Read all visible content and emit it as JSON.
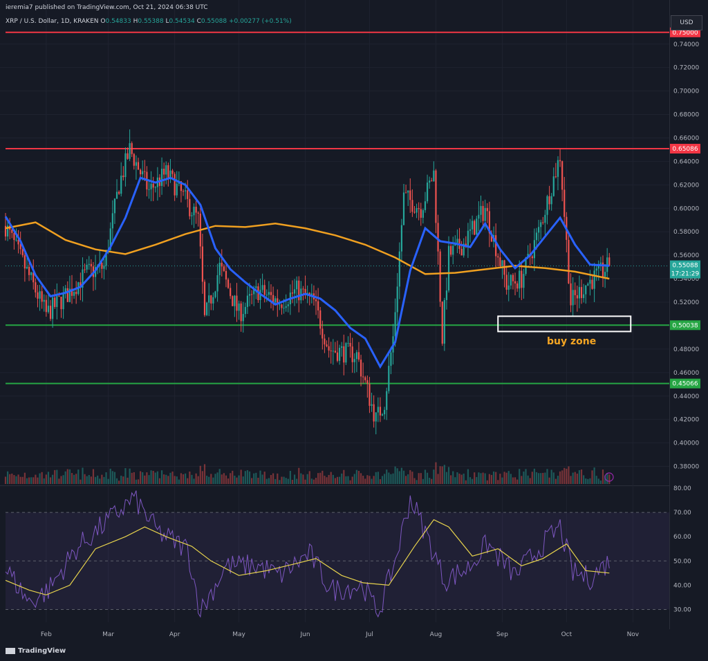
{
  "header": {
    "publisher": "ieremia7 published on TradingView.com, Oct 21, 2024 06:38 UTC",
    "symbol": "XRP / U.S. Dollar, 1D, KRAKEN",
    "o_label": "O",
    "o_value": "0.54833",
    "h_label": "H",
    "h_value": "0.55388",
    "l_label": "L",
    "l_value": "0.54534",
    "c_label": "C",
    "c_value": "0.55088",
    "change": "+0.00277 (+0.51%)"
  },
  "currency": "USD",
  "annotation": "buy zone",
  "watermark": "TradingView",
  "colors": {
    "background": "#161a25",
    "up": "#26a69a",
    "down": "#ef5350",
    "ema_fast": "#2962ff",
    "ema_slow": "#f0a020",
    "resistance": "#f23645",
    "support": "#26a644",
    "rsi": "#7e57c2",
    "rsi_ma": "#e8d44d"
  },
  "price_tags": {
    "top_line": "0.75000",
    "resistance": "0.65086",
    "last": "0.55088",
    "countdown": "17:21:29",
    "support1": "0.50038",
    "support2": "0.45066"
  },
  "chart_data": [
    {
      "type": "candlestick",
      "price_axis": [
        "0.74000",
        "0.72000",
        "0.70000",
        "0.68000",
        "0.66000",
        "0.64000",
        "0.62000",
        "0.60000",
        "0.58000",
        "0.56000",
        "0.54000",
        "0.52000",
        "0.48000",
        "0.46000",
        "0.44000",
        "0.42000",
        "0.40000",
        "0.38000"
      ],
      "ylim": [
        0.365,
        0.754
      ],
      "time_axis": [
        "Feb",
        "Mar",
        "Apr",
        "May",
        "Jun",
        "Jul",
        "Aug",
        "Sep",
        "Oct",
        "Nov"
      ],
      "horizontal_lines": [
        {
          "role": "resistance",
          "value": 0.75
        },
        {
          "role": "resistance",
          "value": 0.65086
        },
        {
          "role": "support",
          "value": 0.50038
        },
        {
          "role": "support",
          "value": 0.45066
        }
      ],
      "buy_zone": {
        "from": 0.495,
        "to": 0.508,
        "x_start": "2024-08-30",
        "x_end": "2024-10-31"
      },
      "ema_fast": [
        [
          "2024-01-13",
          0.593
        ],
        [
          "2024-01-20",
          0.572
        ],
        [
          "2024-01-27",
          0.543
        ],
        [
          "2024-02-03",
          0.525
        ],
        [
          "2024-02-10",
          0.528
        ],
        [
          "2024-02-17",
          0.533
        ],
        [
          "2024-02-24",
          0.547
        ],
        [
          "2024-03-02",
          0.567
        ],
        [
          "2024-03-09",
          0.592
        ],
        [
          "2024-03-16",
          0.626
        ],
        [
          "2024-03-23",
          0.622
        ],
        [
          "2024-03-30",
          0.626
        ],
        [
          "2024-04-06",
          0.62
        ],
        [
          "2024-04-13",
          0.603
        ],
        [
          "2024-04-20",
          0.566
        ],
        [
          "2024-04-27",
          0.548
        ],
        [
          "2024-05-04",
          0.537
        ],
        [
          "2024-05-11",
          0.527
        ],
        [
          "2024-05-18",
          0.518
        ],
        [
          "2024-05-25",
          0.523
        ],
        [
          "2024-06-01",
          0.527
        ],
        [
          "2024-06-08",
          0.523
        ],
        [
          "2024-06-15",
          0.513
        ],
        [
          "2024-06-22",
          0.498
        ],
        [
          "2024-06-29",
          0.489
        ],
        [
          "2024-07-06",
          0.465
        ],
        [
          "2024-07-13",
          0.486
        ],
        [
          "2024-07-20",
          0.547
        ],
        [
          "2024-07-27",
          0.583
        ],
        [
          "2024-08-03",
          0.572
        ],
        [
          "2024-08-10",
          0.57
        ],
        [
          "2024-08-17",
          0.567
        ],
        [
          "2024-08-24",
          0.587
        ],
        [
          "2024-08-31",
          0.565
        ],
        [
          "2024-09-07",
          0.549
        ],
        [
          "2024-09-14",
          0.56
        ],
        [
          "2024-09-21",
          0.576
        ],
        [
          "2024-09-28",
          0.592
        ],
        [
          "2024-10-05",
          0.569
        ],
        [
          "2024-10-12",
          0.552
        ],
        [
          "2024-10-21",
          0.551
        ]
      ],
      "ema_slow": [
        [
          "2024-01-13",
          0.583
        ],
        [
          "2024-01-27",
          0.588
        ],
        [
          "2024-02-10",
          0.573
        ],
        [
          "2024-02-24",
          0.565
        ],
        [
          "2024-03-09",
          0.561
        ],
        [
          "2024-03-23",
          0.569
        ],
        [
          "2024-04-06",
          0.578
        ],
        [
          "2024-04-20",
          0.585
        ],
        [
          "2024-05-04",
          0.584
        ],
        [
          "2024-05-18",
          0.587
        ],
        [
          "2024-06-01",
          0.583
        ],
        [
          "2024-06-15",
          0.577
        ],
        [
          "2024-06-29",
          0.569
        ],
        [
          "2024-07-13",
          0.558
        ],
        [
          "2024-07-27",
          0.544
        ],
        [
          "2024-08-10",
          0.545
        ],
        [
          "2024-08-24",
          0.548
        ],
        [
          "2024-09-07",
          0.551
        ],
        [
          "2024-09-21",
          0.549
        ],
        [
          "2024-10-05",
          0.546
        ],
        [
          "2024-10-21",
          0.54
        ]
      ],
      "candles": {
        "start": "2024-01-13",
        "end": "2024-10-21",
        "close_anchors": [
          [
            "2024-01-13",
            0.585
          ],
          [
            "2024-01-22",
            0.55
          ],
          [
            "2024-02-01",
            0.51
          ],
          [
            "2024-02-10",
            0.525
          ],
          [
            "2024-02-20",
            0.545
          ],
          [
            "2024-02-28",
            0.55
          ],
          [
            "2024-03-06",
            0.62
          ],
          [
            "2024-03-11",
            0.65
          ],
          [
            "2024-03-20",
            0.615
          ],
          [
            "2024-03-28",
            0.63
          ],
          [
            "2024-04-05",
            0.61
          ],
          [
            "2024-04-12",
            0.59
          ],
          [
            "2024-04-15",
            0.505
          ],
          [
            "2024-04-22",
            0.55
          ],
          [
            "2024-05-01",
            0.51
          ],
          [
            "2024-05-10",
            0.53
          ],
          [
            "2024-05-20",
            0.52
          ],
          [
            "2024-05-28",
            0.53
          ],
          [
            "2024-06-05",
            0.52
          ],
          [
            "2024-06-12",
            0.48
          ],
          [
            "2024-06-25",
            0.475
          ],
          [
            "2024-07-04",
            0.42
          ],
          [
            "2024-07-08",
            0.435
          ],
          [
            "2024-07-12",
            0.49
          ],
          [
            "2024-07-17",
            0.61
          ],
          [
            "2024-07-25",
            0.6
          ],
          [
            "2024-07-31",
            0.63
          ],
          [
            "2024-08-04",
            0.49
          ],
          [
            "2024-08-07",
            0.56
          ],
          [
            "2024-08-14",
            0.57
          ],
          [
            "2024-08-24",
            0.6
          ],
          [
            "2024-09-03",
            0.535
          ],
          [
            "2024-09-10",
            0.54
          ],
          [
            "2024-09-18",
            0.58
          ],
          [
            "2024-09-28",
            0.645
          ],
          [
            "2024-10-03",
            0.52
          ],
          [
            "2024-10-10",
            0.535
          ],
          [
            "2024-10-21",
            0.551
          ]
        ]
      }
    },
    {
      "type": "line",
      "title": "RSI",
      "ylim": [
        25,
        80
      ],
      "axis": [
        "80.00",
        "70.00",
        "60.00",
        "50.00",
        "40.00",
        "30.00"
      ],
      "band": [
        30,
        70
      ],
      "rsi_ma": [
        [
          "2024-01-13",
          42
        ],
        [
          "2024-01-24",
          38
        ],
        [
          "2024-02-01",
          36
        ],
        [
          "2024-02-12",
          40
        ],
        [
          "2024-02-24",
          55
        ],
        [
          "2024-03-09",
          60
        ],
        [
          "2024-03-18",
          64
        ],
        [
          "2024-03-28",
          60
        ],
        [
          "2024-04-09",
          56
        ],
        [
          "2024-04-18",
          50
        ],
        [
          "2024-05-01",
          44
        ],
        [
          "2024-05-14",
          46
        ],
        [
          "2024-05-28",
          49
        ],
        [
          "2024-06-06",
          51
        ],
        [
          "2024-06-18",
          44
        ],
        [
          "2024-06-28",
          41
        ],
        [
          "2024-07-10",
          40
        ],
        [
          "2024-07-22",
          56
        ],
        [
          "2024-07-31",
          67
        ],
        [
          "2024-08-07",
          64
        ],
        [
          "2024-08-18",
          52
        ],
        [
          "2024-08-30",
          55
        ],
        [
          "2024-09-10",
          48
        ],
        [
          "2024-09-20",
          51
        ],
        [
          "2024-10-01",
          57
        ],
        [
          "2024-10-10",
          46
        ],
        [
          "2024-10-21",
          45
        ]
      ],
      "rsi_anchors": [
        [
          "2024-01-13",
          47
        ],
        [
          "2024-01-24",
          33
        ],
        [
          "2024-02-02",
          38
        ],
        [
          "2024-02-15",
          55
        ],
        [
          "2024-03-08",
          72
        ],
        [
          "2024-03-13",
          76
        ],
        [
          "2024-03-24",
          62
        ],
        [
          "2024-04-07",
          55
        ],
        [
          "2024-04-13",
          29
        ],
        [
          "2024-04-25",
          48
        ],
        [
          "2024-05-10",
          48
        ],
        [
          "2024-05-20",
          44
        ],
        [
          "2024-06-03",
          53
        ],
        [
          "2024-06-13",
          38
        ],
        [
          "2024-06-28",
          40
        ],
        [
          "2024-07-05",
          28
        ],
        [
          "2024-07-13",
          50
        ],
        [
          "2024-07-20",
          76
        ],
        [
          "2024-07-28",
          60
        ],
        [
          "2024-08-05",
          42
        ],
        [
          "2024-08-16",
          47
        ],
        [
          "2024-08-25",
          57
        ],
        [
          "2024-09-07",
          44
        ],
        [
          "2024-09-18",
          55
        ],
        [
          "2024-09-28",
          64
        ],
        [
          "2024-10-04",
          45
        ],
        [
          "2024-10-12",
          43
        ],
        [
          "2024-10-21",
          50
        ]
      ]
    }
  ]
}
